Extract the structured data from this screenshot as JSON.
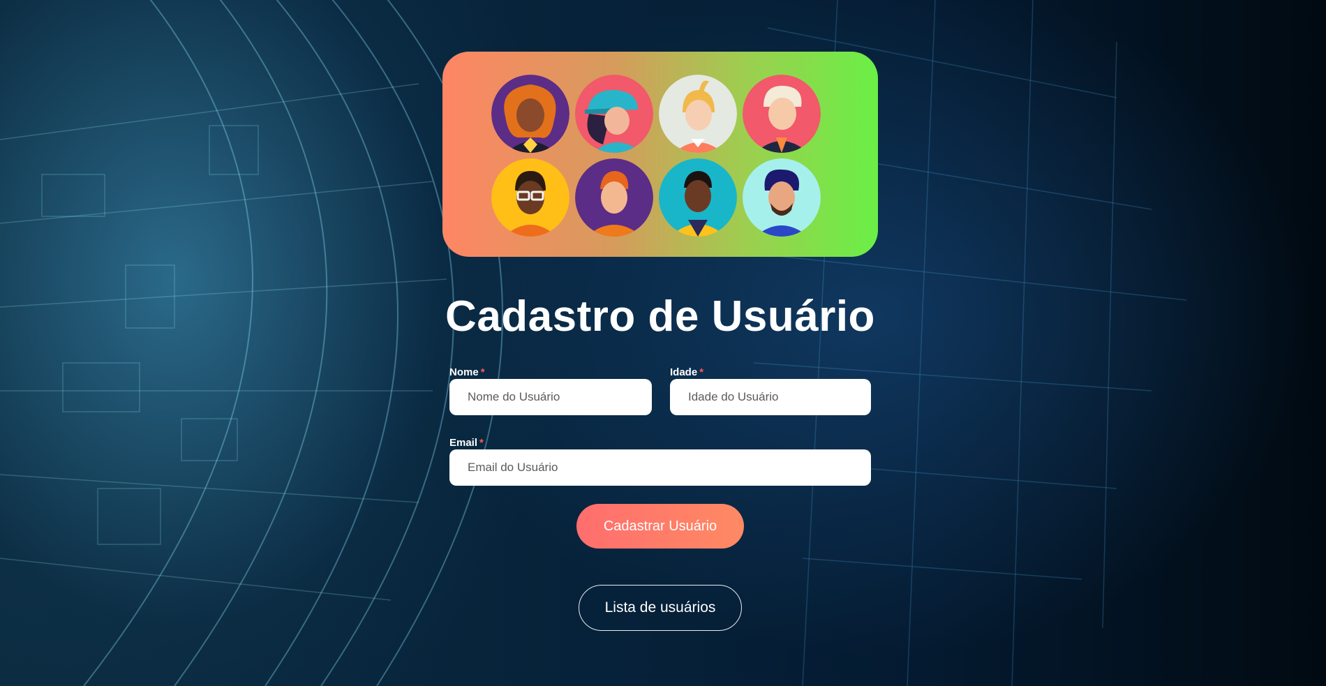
{
  "title": "Cadastro de Usuário",
  "form": {
    "nome": {
      "label": "Nome",
      "required_mark": "*",
      "placeholder": "Nome do Usuário",
      "value": ""
    },
    "idade": {
      "label": "Idade",
      "required_mark": "*",
      "placeholder": "Idade do Usuário",
      "value": ""
    },
    "email": {
      "label": "Email",
      "required_mark": "*",
      "placeholder": "Email do Usuário",
      "value": ""
    }
  },
  "buttons": {
    "submit": "Cadastrar Usuário",
    "list": "Lista de usuários"
  },
  "colors": {
    "banner_gradient_start": "#ff8664",
    "banner_gradient_end": "#6aef46",
    "primary_button": "#ff7a68",
    "required_mark": "#ff5a5a"
  },
  "avatars": [
    {
      "icon": "woman-orange-curly-hair-avatar",
      "bg": "#5b2d86"
    },
    {
      "icon": "person-blue-cap-avatar",
      "bg": "#f2596a"
    },
    {
      "icon": "woman-blonde-ponytail-avatar",
      "bg": "#e4e9e2"
    },
    {
      "icon": "man-white-hair-avatar",
      "bg": "#f2596a"
    },
    {
      "icon": "man-glasses-avatar",
      "bg": "#ffbf16"
    },
    {
      "icon": "man-red-hair-avatar",
      "bg": "#5b2d86"
    },
    {
      "icon": "man-hoodie-avatar",
      "bg": "#19b6c9"
    },
    {
      "icon": "man-curly-hair-beard-avatar",
      "bg": "#a6f0ec"
    }
  ]
}
